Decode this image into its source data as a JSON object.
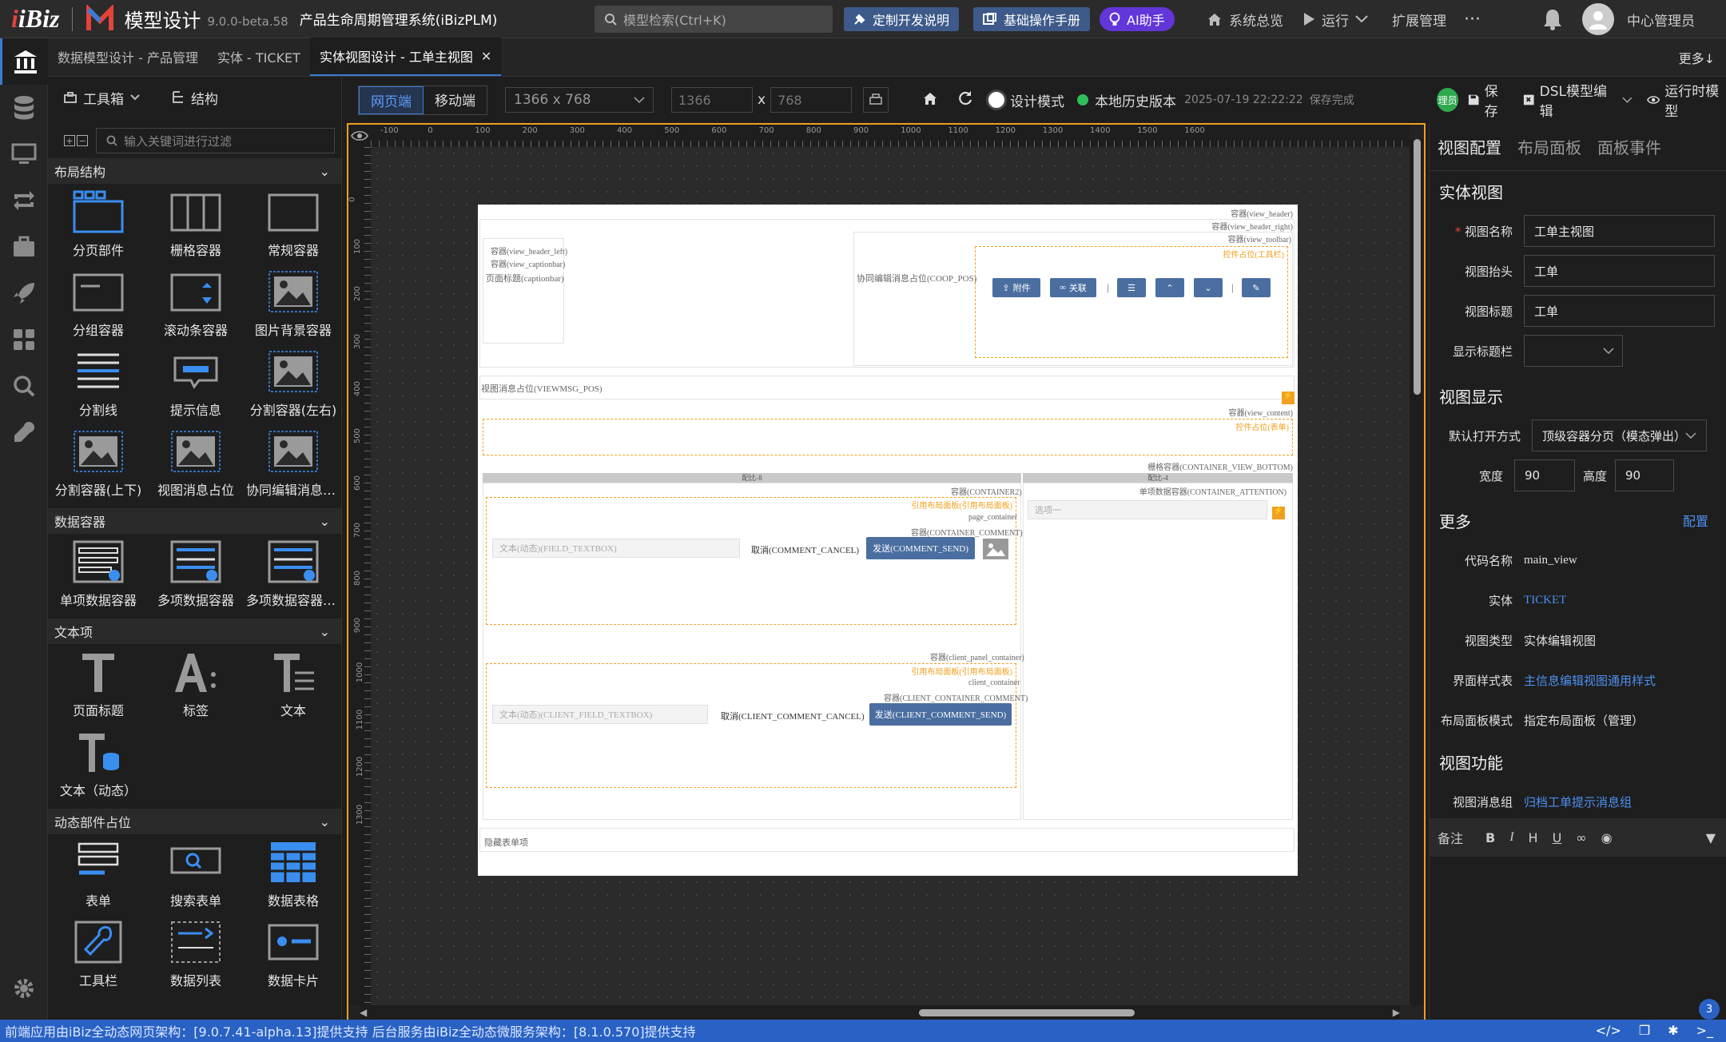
{
  "header": {
    "brand": "iBiz",
    "title": "模型设计",
    "version": "9.0.0-beta.58",
    "system": "产品生命周期管理系统(iBizPLM)",
    "search_placeholder": "模型检索(Ctrl+K)",
    "btn_custom_dev": "定制开发说明",
    "btn_manual": "基础操作手册",
    "btn_ai": "AI助手",
    "nav_overview": "系统总览",
    "nav_run": "运行",
    "nav_ext": "扩展管理",
    "user": "中心管理员"
  },
  "tabs": [
    {
      "label": "数据模型设计 - 产品管理"
    },
    {
      "label": "实体 - TICKET"
    },
    {
      "label": "实体视图设计 - 工单主视图"
    }
  ],
  "tabs_more": "更多",
  "left_panel": {
    "toolbox": "工具箱",
    "structure": "结构",
    "filter_placeholder": "输入关键词进行过滤",
    "sections": [
      {
        "title": "布局结构",
        "items": [
          "分页部件",
          "栅格容器",
          "常规容器",
          "分组容器",
          "滚动条容器",
          "图片背景容器",
          "分割线",
          "提示信息",
          "分割容器(左右)",
          "分割容器(上下)",
          "视图消息占位",
          "协同编辑消息占位"
        ]
      },
      {
        "title": "数据容器",
        "items": [
          "单项数据容器",
          "多项数据容器",
          "多项数据容器(分页)"
        ]
      },
      {
        "title": "文本项",
        "items": [
          "页面标题",
          "标签",
          "文本",
          "文本（动态）"
        ]
      },
      {
        "title": "动态部件占位",
        "items": [
          "表单",
          "搜索表单",
          "数据表格",
          "工具栏",
          "数据列表",
          "数据卡片"
        ]
      }
    ]
  },
  "canvas_toolbar": {
    "web": "网页端",
    "mobile": "移动端",
    "resolution": "1366 x 768",
    "width": "1366",
    "height": "768",
    "x": "x",
    "design_mode": "设计模式",
    "history": "本地历史版本",
    "saved_time": "2025-07-19 22:22:22",
    "saved_status": "保存完成"
  },
  "canvas": {
    "ruler_marks": [
      "-100",
      "0",
      "100",
      "200",
      "300",
      "400",
      "500",
      "600",
      "700",
      "800",
      "900",
      "1000",
      "1100",
      "1200",
      "1300",
      "1400",
      "1500",
      "1600"
    ],
    "vruler_marks": [
      "0",
      "100",
      "200",
      "300",
      "400",
      "500",
      "600",
      "700",
      "800",
      "900",
      "1000",
      "1100",
      "1200",
      "1300"
    ],
    "labels": {
      "view_header": "容器(view_header)",
      "view_header_right": "容器(view_header_right)",
      "view_toolbar": "容器(view_toolbar)",
      "toolbar_ph": "控件占位(工具栏)",
      "view_header_left": "容器(view_header_left)",
      "view_captionbar": "容器(view_captionbar)",
      "captionbar": "页面标题(captionbar)",
      "coop_pos": "协同编辑消息占位(COOP_POS)",
      "btn_attach": "附件",
      "btn_link": "关联",
      "viewmsg": "视图消息占位(VIEWMSG_POS)",
      "view_content": "容器(view_content)",
      "form_ph": "控件占位(表单)",
      "bottom": "栅格容器(CONTAINER_VIEW_BOTTOM)",
      "col8": "配比-8",
      "col4": "配比-4",
      "container2": "容器(CONTAINER2)",
      "ref_panel": "引用布局面板(引用布局面板)",
      "page_container": "page_container",
      "container_comment": "容器(CONTAINER_COMMENT)",
      "field_textbox": "文本(动态)(FIELD_TEXTBOX)",
      "comment_cancel": "取消(COMMENT_CANCEL)",
      "comment_send": "发送(COMMENT_SEND)",
      "attention": "单项数据容器(CONTAINER_ATTENTION)",
      "choose": "选项一",
      "client_panel": "容器(client_panel_container)",
      "ref_panel2": "引用布局面板(引用布局面板)",
      "client_container": "client_container",
      "client_comment": "容器(CLIENT_CONTAINER_COMMENT)",
      "client_field": "文本(动态)(CLIENT_FIELD_TEXTBOX)",
      "client_cancel": "取消(CLIENT_COMMENT_CANCEL)",
      "client_send": "发送(CLIENT_COMMENT_SEND)",
      "hidden_form": "隐藏表单项"
    }
  },
  "right_toolbar": {
    "role": "理员",
    "save": "保存",
    "dsl": "DSL模型编辑",
    "runtime": "运行时模型"
  },
  "right_panel": {
    "tabs": [
      "视图配置",
      "布局面板",
      "面板事件"
    ],
    "section1": "实体视图",
    "view_name_label": "视图名称",
    "view_name": "工单主视图",
    "view_caption_label": "视图抬头",
    "view_caption": "工单",
    "view_title_label": "视图标题",
    "view_title": "工单",
    "show_titlebar_label": "显示标题栏",
    "section2": "视图显示",
    "open_mode_label": "默认打开方式",
    "open_mode": "顶级容器分页（模态弹出）",
    "width_label": "宽度",
    "width": "90",
    "height_label": "高度",
    "height": "90",
    "section3": "更多",
    "config": "配置",
    "code_label": "代码名称",
    "code": "main_view",
    "entity_label": "实体",
    "entity": "TICKET",
    "view_type_label": "视图类型",
    "view_type": "实体编辑视图",
    "style_label": "界面样式表",
    "style": "主信息编辑视图通用样式",
    "layout_mode_label": "布局面板模式",
    "layout_mode": "指定布局面板（管理）",
    "section4": "视图功能",
    "msg_group_label": "视图消息组",
    "msg_group": "归档工单提示消息组",
    "remark_label": "备注"
  },
  "status": {
    "text": "前端应用由iBiz全动态网页架构：[9.0.7.41-alpha.13]提供支持 后台服务由iBiz全动态微服务架构：[8.1.0.570]提供支持",
    "badge": "3"
  },
  "colors": {
    "accent": "#3a7bd5",
    "orange": "#f0a020",
    "status": "#2962c4",
    "ai": "#6236d8"
  }
}
